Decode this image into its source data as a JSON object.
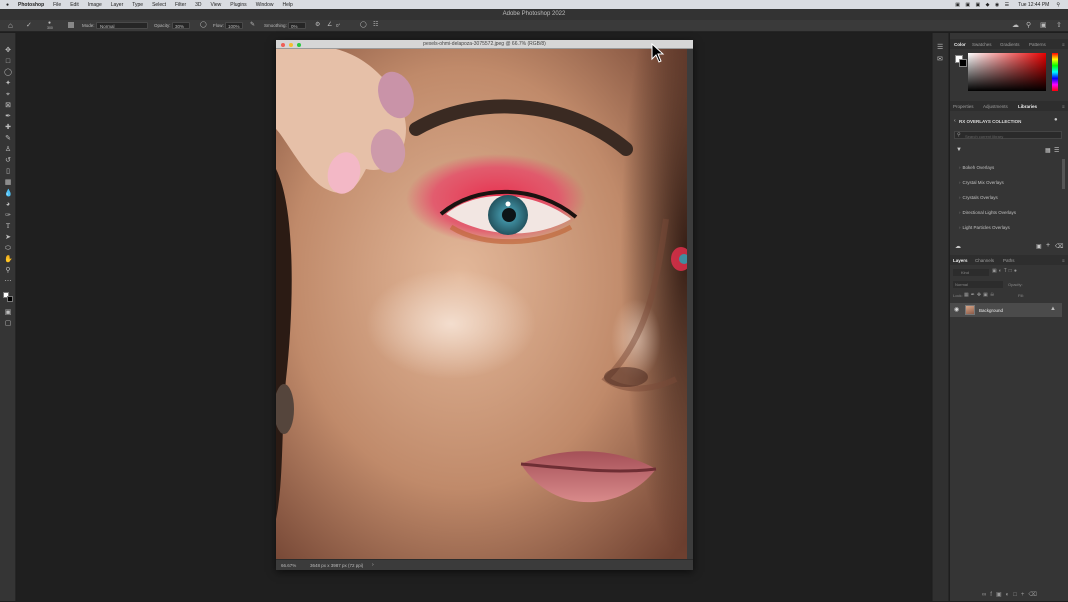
{
  "menubar": {
    "app": "Photoshop",
    "items": [
      "File",
      "Edit",
      "Image",
      "Layer",
      "Type",
      "Select",
      "Filter",
      "3D",
      "View",
      "Plugins",
      "Window",
      "Help"
    ],
    "clock": "Tue 12:44 PM"
  },
  "window": {
    "title": "Adobe Photoshop 2022"
  },
  "options": {
    "mode_label": "Mode:",
    "mode_value": "Normal",
    "opacity_label": "Opacity:",
    "opacity_value": "30%",
    "flow_label": "Flow:",
    "flow_value": "100%",
    "smoothing_label": "Smoothing:",
    "smoothing_value": "0%",
    "angle_value": "0°",
    "brush_size": "300"
  },
  "document": {
    "tab_title": "pexels-ohmi-delapoza-3075572.jpeg @ 66.7% (RGB/8)",
    "zoom": "66.67%",
    "info": "3648 px x 3987 px (72 ppi)"
  },
  "panels": {
    "top_tabs": [
      "Color",
      "Swatches",
      "Gradients",
      "Patterns"
    ],
    "mid_tabs": [
      "Properties",
      "Adjustments",
      "Libraries"
    ],
    "library_header": "RX OVERLAYS COLLECTION",
    "library_search_placeholder": "Search current library",
    "library_groups": [
      "Bokeh Overlays",
      "Crystal Mix Overlays",
      "Crystals Overlays",
      "Directional Lights Overlays",
      "Light Particles Overlays"
    ],
    "layers_tabs": [
      "Layers",
      "Channels",
      "Paths"
    ],
    "layers_kind": "Kind",
    "blend_mode": "Normal",
    "opacity_label": "Opacity:",
    "lock_label": "Lock:",
    "fill_label": "Fill:",
    "layer_name": "Background"
  },
  "colors": {
    "accent_active_tab": "#f0f0f0",
    "panel_bg": "#353535"
  }
}
